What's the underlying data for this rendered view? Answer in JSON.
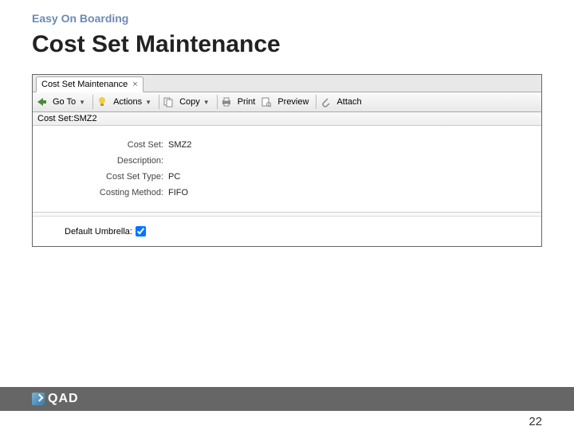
{
  "slide": {
    "breadcrumb": "Easy On Boarding",
    "title": "Cost Set Maintenance",
    "page_number": "22"
  },
  "tab": {
    "label": "Cost Set Maintenance"
  },
  "toolbar": {
    "goto": "Go To",
    "actions": "Actions",
    "copy": "Copy",
    "print": "Print",
    "preview": "Preview",
    "attach": "Attach"
  },
  "breadcrumb_row": {
    "label": "Cost Set:",
    "value": "SMZ2"
  },
  "form": {
    "cost_set": {
      "label": "Cost Set:",
      "value": "SMZ2"
    },
    "description": {
      "label": "Description:",
      "value": ""
    },
    "type": {
      "label": "Cost Set Type:",
      "value": "PC"
    },
    "method": {
      "label": "Costing Method:",
      "value": "FIFO"
    },
    "umbrella": {
      "label": "Default Umbrella:"
    }
  },
  "brand": {
    "name": "QAD"
  }
}
